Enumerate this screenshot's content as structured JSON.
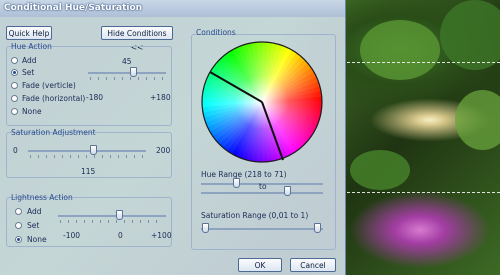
{
  "dialog": {
    "title": "Conditional Hue/Saturation",
    "quick_help": "Quick Help",
    "hide_conditions": "Hide Conditions <<",
    "ok": "OK",
    "cancel": "Cancel"
  },
  "hue_action": {
    "title": "Hue Action",
    "options": [
      "Add",
      "Set",
      "Fade (verticle)",
      "Fade (horizontal)",
      "None"
    ],
    "selected": "Set",
    "value": "45",
    "min_label": "-180",
    "max_label": "+180",
    "slider_value": 45
  },
  "saturation": {
    "title": "Saturation Adjustment",
    "min_label": "0",
    "max_label": "200",
    "value": "115",
    "slider_value": 115
  },
  "lightness": {
    "title": "Lightness Action",
    "options": [
      "Add",
      "Set",
      "None"
    ],
    "selected": "None",
    "min_label": "-100",
    "mid_label": "0",
    "max_label": "+100"
  },
  "conditions": {
    "title": "Conditions",
    "hue_range_label": "Hue Range (218 to 71)",
    "to_label": "to",
    "sat_range_label": "Saturation Range (0,01 to 1)"
  },
  "colors": {
    "panel": "#d6e2ee",
    "label_blue": "#2a4d8f",
    "border": "#9fb3cc"
  },
  "icons": [
    "radio-icon",
    "slider-thumb-icon",
    "color-wheel-icon"
  ]
}
